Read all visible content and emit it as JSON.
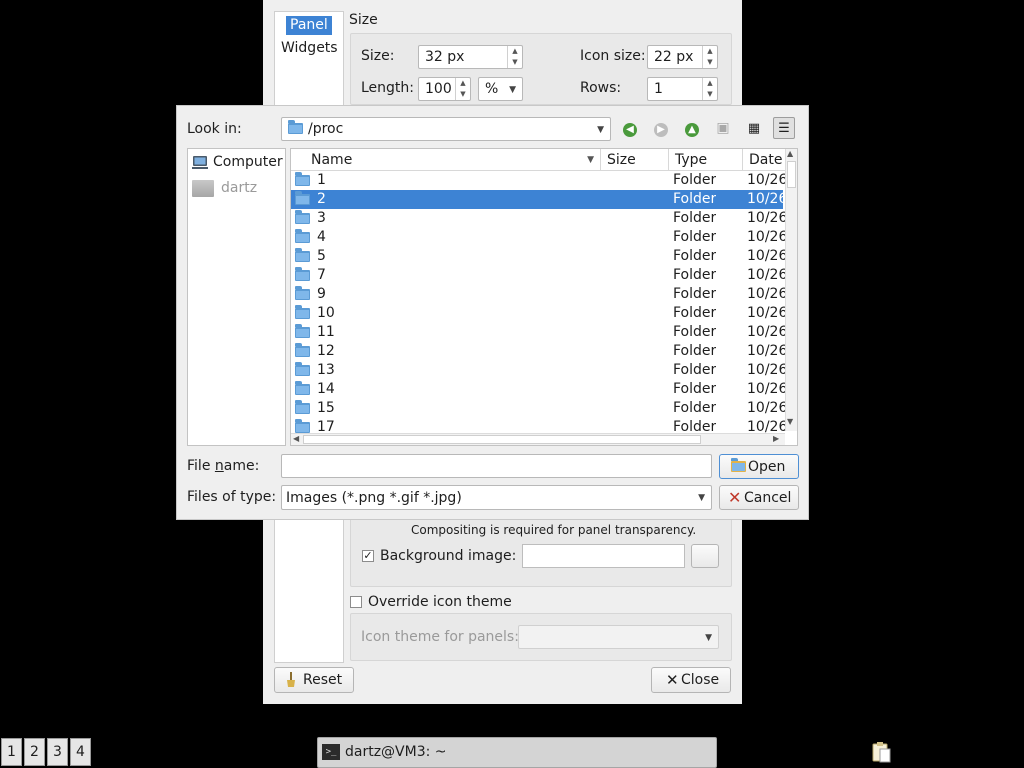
{
  "settings_window": {
    "tabs": [
      "Panel",
      "Widgets"
    ],
    "size_group_title": "Size",
    "size_label": "Size:",
    "size_value": "32 px",
    "icon_size_label": "Icon size:",
    "icon_size_value": "22 px",
    "length_label": "Length:",
    "length_value": "100",
    "length_unit": "%",
    "rows_label": "Rows:",
    "rows_value": "1",
    "compositing_note": "Compositing is required for panel transparency.",
    "background_image_label": "Background image:",
    "background_image_checked": true,
    "override_icon_theme_label": "Override icon theme",
    "icon_theme_label": "Icon theme for panels:",
    "reset_label": "Reset",
    "close_label": "Close"
  },
  "file_dialog": {
    "look_in_label": "Look in:",
    "look_in_value": "/proc",
    "sidebar": [
      {
        "label": "Computer",
        "icon": "computer-icon"
      },
      {
        "label": "dartz",
        "icon": "drive-icon"
      }
    ],
    "columns": [
      "Name",
      "Size",
      "Type",
      "Date M"
    ],
    "rows": [
      {
        "name": "1",
        "type": "Folder",
        "date": "10/26"
      },
      {
        "name": "2",
        "type": "Folder",
        "date": "10/26",
        "selected": true
      },
      {
        "name": "3",
        "type": "Folder",
        "date": "10/26"
      },
      {
        "name": "4",
        "type": "Folder",
        "date": "10/26"
      },
      {
        "name": "5",
        "type": "Folder",
        "date": "10/26"
      },
      {
        "name": "7",
        "type": "Folder",
        "date": "10/26"
      },
      {
        "name": "9",
        "type": "Folder",
        "date": "10/26"
      },
      {
        "name": "10",
        "type": "Folder",
        "date": "10/26"
      },
      {
        "name": "11",
        "type": "Folder",
        "date": "10/26"
      },
      {
        "name": "12",
        "type": "Folder",
        "date": "10/26"
      },
      {
        "name": "13",
        "type": "Folder",
        "date": "10/26"
      },
      {
        "name": "14",
        "type": "Folder",
        "date": "10/26"
      },
      {
        "name": "15",
        "type": "Folder",
        "date": "10/26"
      },
      {
        "name": "17",
        "type": "Folder",
        "date": "10/26"
      }
    ],
    "file_name_label_pre": "File ",
    "file_name_label_u": "n",
    "file_name_label_post": "ame:",
    "file_name_value": "",
    "files_of_type_label": "Files of type:",
    "files_of_type_value": "Images (*.png *.gif *.jpg)",
    "open_label": "Open",
    "cancel_label": "Cancel",
    "accent_color": "#3d83d4"
  },
  "taskbar": {
    "workspaces": [
      "1",
      "2",
      "3",
      "4"
    ],
    "task_label": "dartz@VM3: ~"
  }
}
